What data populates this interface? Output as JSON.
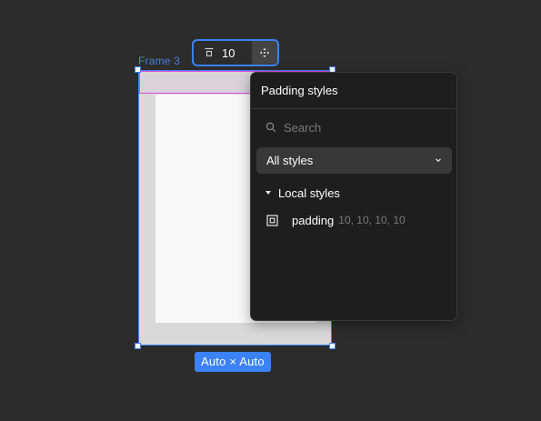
{
  "canvas": {
    "frame_label": "Frame 3",
    "size_badge": "Auto × Auto"
  },
  "padding_control": {
    "value": "10",
    "icon": "padding-top-icon",
    "move_icon": "move-arrows-icon"
  },
  "popover": {
    "title": "Padding styles",
    "search": {
      "placeholder": "Search",
      "value": ""
    },
    "filter": {
      "selected": "All styles"
    },
    "section": {
      "label": "Local styles"
    },
    "items": [
      {
        "name": "padding",
        "value": "10, 10, 10, 10",
        "icon": "padding-style-icon"
      }
    ]
  },
  "colors": {
    "selection": "#3b82f6",
    "padding_highlight": "#e04ae0",
    "canvas_bg": "#2c2c2c",
    "popover_bg": "#1e1e1e"
  }
}
